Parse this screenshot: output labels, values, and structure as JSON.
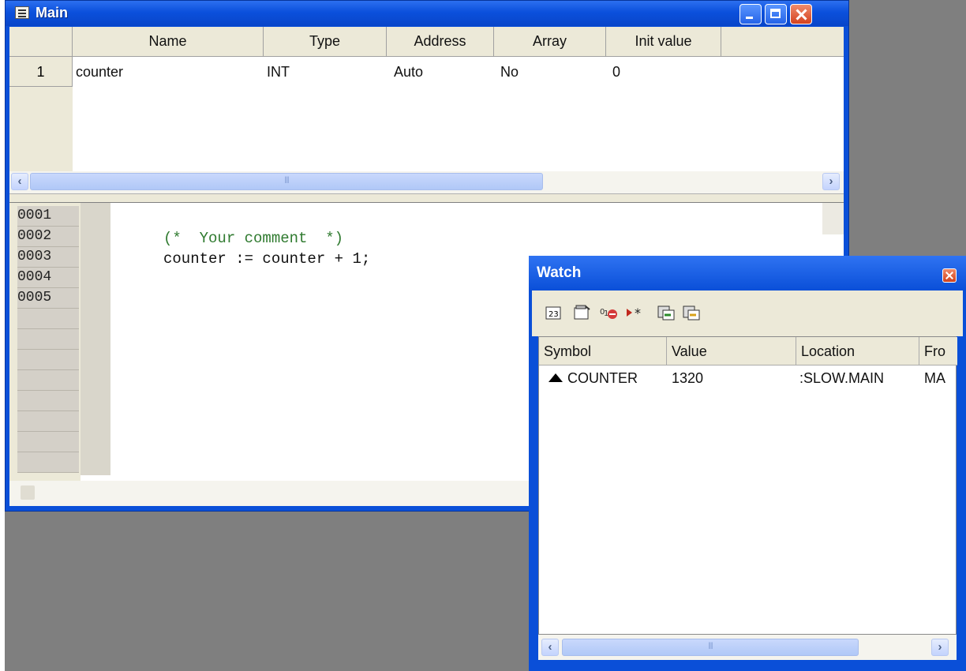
{
  "main_window": {
    "title": "Main",
    "columns": [
      "Name",
      "Type",
      "Address",
      "Array",
      "Init value"
    ],
    "rows": [
      {
        "num": "1",
        "name": "counter",
        "type": "INT",
        "address": "Auto",
        "array": "No",
        "init_value": "0"
      }
    ],
    "line_numbers": [
      "0001",
      "0002",
      "0003",
      "0004",
      "0005"
    ],
    "code": {
      "line2": "(*  Your comment  *)",
      "line3": "counter := counter + 1;"
    }
  },
  "watch_window": {
    "title": "Watch",
    "toolbar_icons": [
      "watch-add-icon",
      "properties-icon",
      "remove-watch-icon",
      "goto-icon",
      "export-icon",
      "import-icon"
    ],
    "columns": [
      "Symbol",
      "Value",
      "Location",
      "Fro"
    ],
    "rows": [
      {
        "symbol": "COUNTER",
        "value": "1320",
        "location": ":SLOW.MAIN",
        "from": "MA"
      }
    ]
  },
  "colors": {
    "titlebar": "#0a4fd8",
    "comment": "#2f7a2f",
    "panel": "#ece9d8",
    "desktop": "#7f7f7f"
  }
}
